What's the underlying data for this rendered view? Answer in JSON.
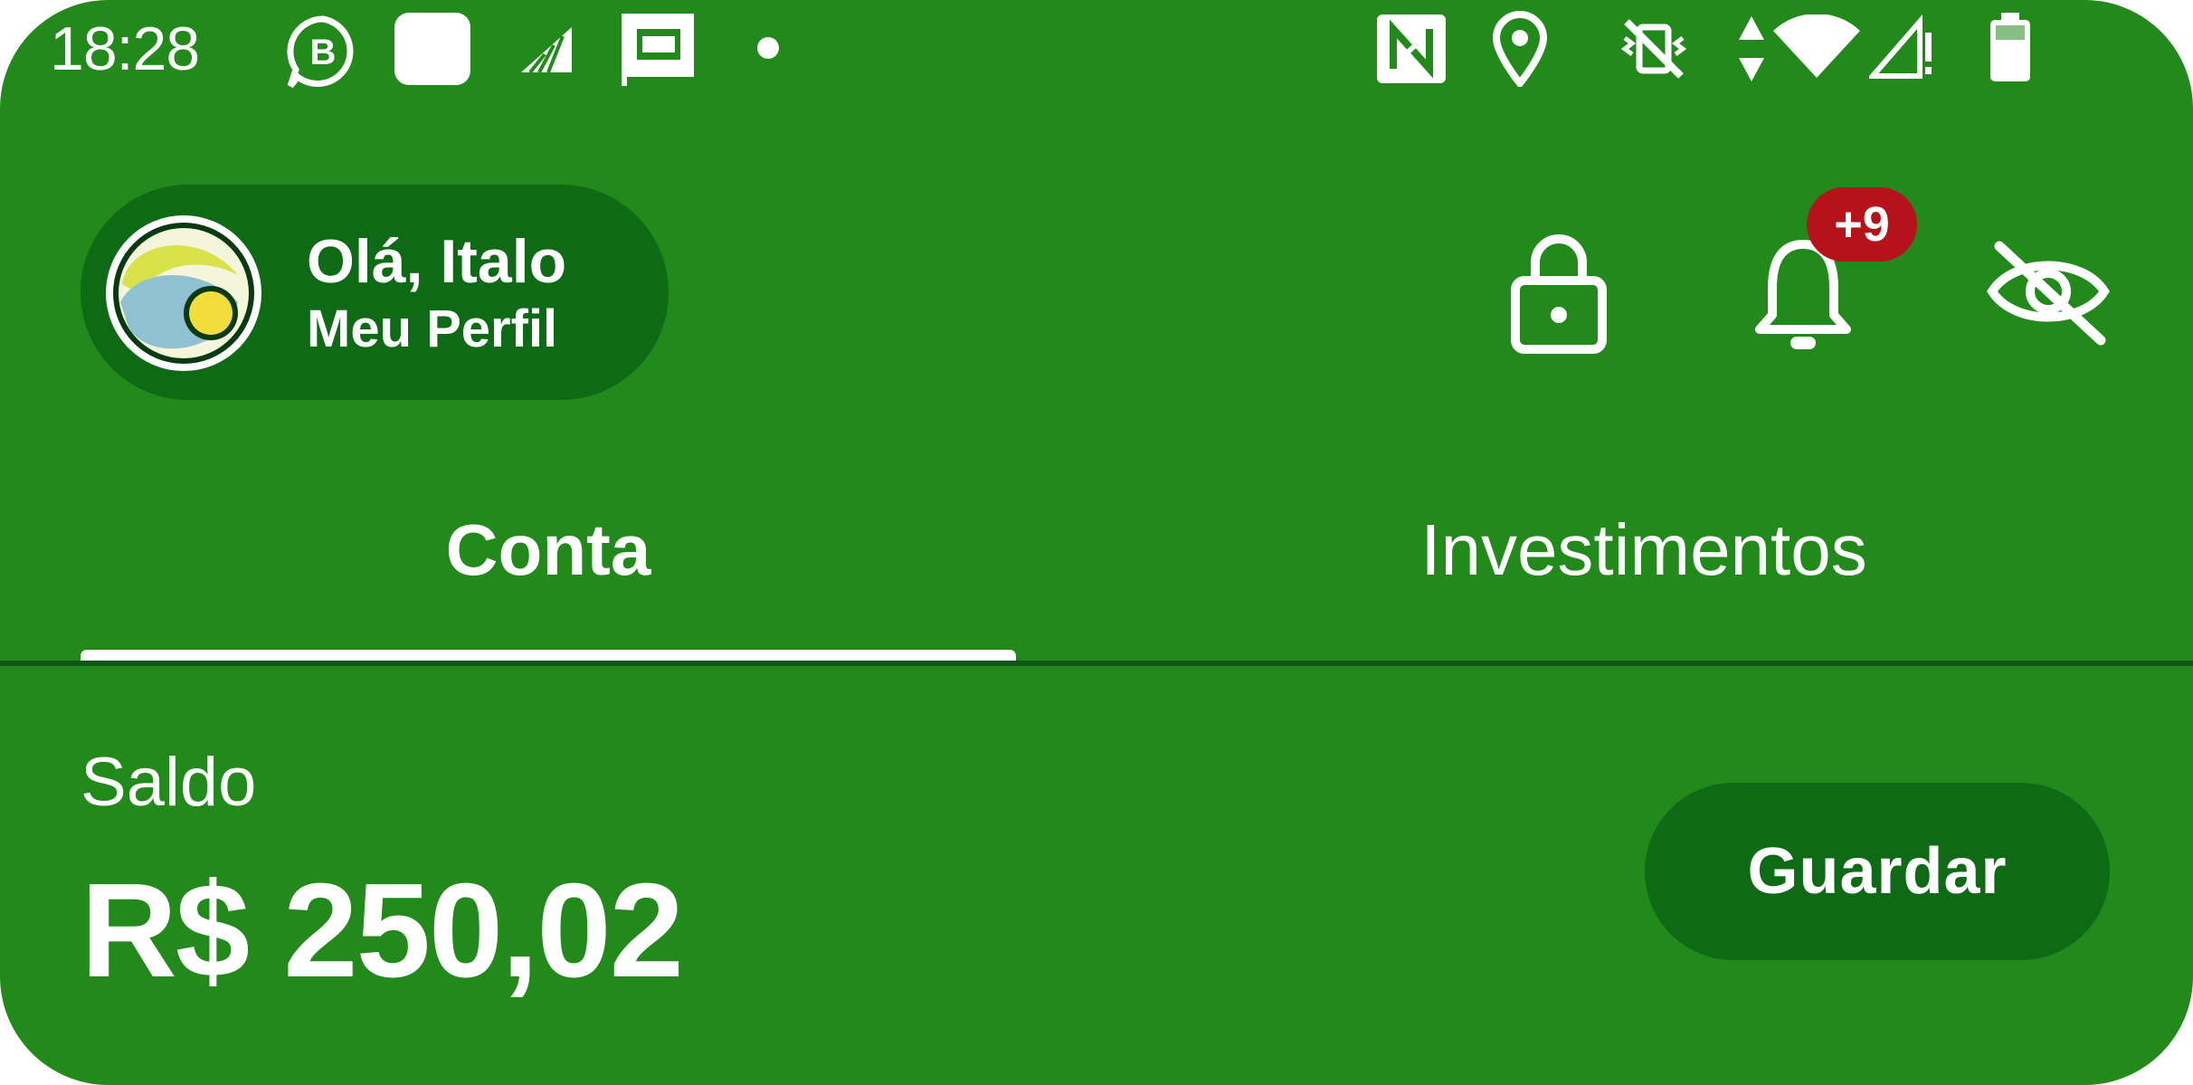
{
  "status_bar": {
    "time": "18:28",
    "left_icons": [
      "whatsapp-business-icon",
      "app-notification-icon",
      "signal-app-icon",
      "news-app-icon",
      "notification-dot-icon"
    ],
    "right_icons": [
      "nfc-icon",
      "location-icon",
      "vibrate-off-icon",
      "data-arrows-icon",
      "wifi-icon",
      "cell-signal-icon",
      "battery-icon"
    ]
  },
  "header": {
    "greeting": "Olá, Italo",
    "profile_link": "Meu Perfil",
    "notification_badge": "+9",
    "icons": [
      "lock-icon",
      "bell-icon",
      "eye-off-icon"
    ]
  },
  "tabs": [
    {
      "label": "Conta",
      "active": true
    },
    {
      "label": "Investimentos",
      "active": false
    }
  ],
  "balance": {
    "label": "Saldo",
    "value": "R$ 250,02",
    "action_label": "Guardar"
  },
  "colors": {
    "background": "#218a1a",
    "pill": "#0f6a15",
    "badge": "#b5121b",
    "text": "#ffffff"
  }
}
